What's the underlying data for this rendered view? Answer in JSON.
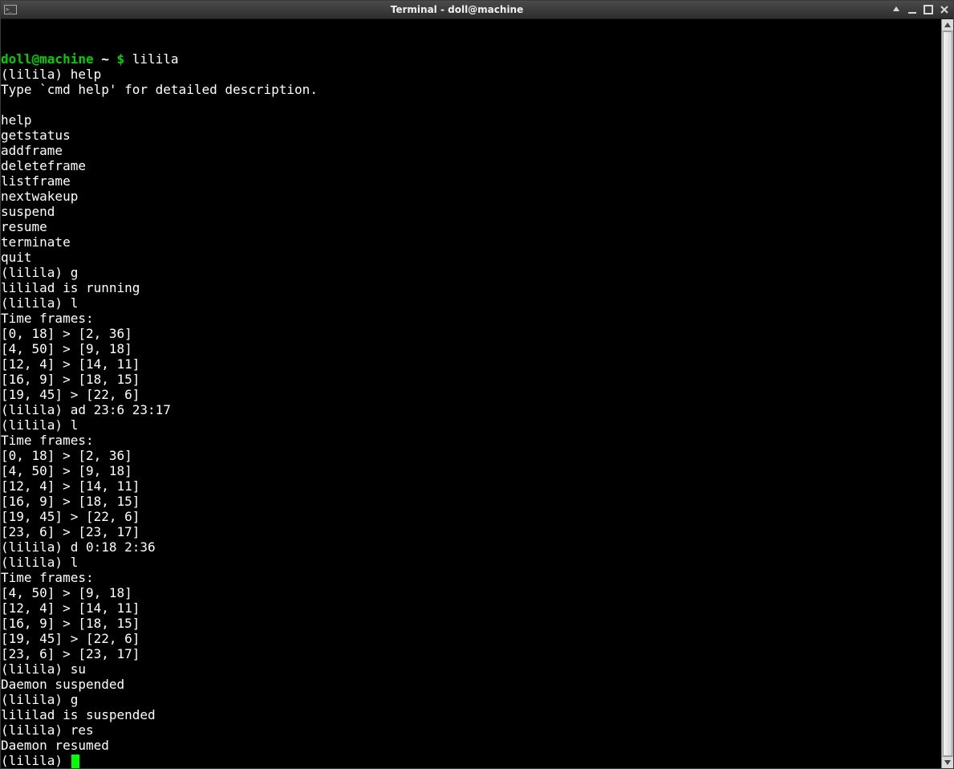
{
  "window": {
    "title": "Terminal - doll@machine"
  },
  "prompt": {
    "user_host": "doll@machine",
    "separator": " ~",
    "sign": " $ ",
    "command": "lilila",
    "sub_prompt": "(lilila) "
  },
  "session": {
    "lines": [
      {
        "t": "shell_prompt"
      },
      {
        "t": "sub",
        "in": "help"
      },
      {
        "t": "out",
        "v": "Type `cmd help' for detailed description."
      },
      {
        "t": "out",
        "v": ""
      },
      {
        "t": "out",
        "v": "help"
      },
      {
        "t": "out",
        "v": "getstatus"
      },
      {
        "t": "out",
        "v": "addframe"
      },
      {
        "t": "out",
        "v": "deleteframe"
      },
      {
        "t": "out",
        "v": "listframe"
      },
      {
        "t": "out",
        "v": "nextwakeup"
      },
      {
        "t": "out",
        "v": "suspend"
      },
      {
        "t": "out",
        "v": "resume"
      },
      {
        "t": "out",
        "v": "terminate"
      },
      {
        "t": "out",
        "v": "quit"
      },
      {
        "t": "sub",
        "in": "g"
      },
      {
        "t": "out",
        "v": "lililad is running"
      },
      {
        "t": "sub",
        "in": "l"
      },
      {
        "t": "out",
        "v": "Time frames:"
      },
      {
        "t": "out",
        "v": "[0, 18] > [2, 36]"
      },
      {
        "t": "out",
        "v": "[4, 50] > [9, 18]"
      },
      {
        "t": "out",
        "v": "[12, 4] > [14, 11]"
      },
      {
        "t": "out",
        "v": "[16, 9] > [18, 15]"
      },
      {
        "t": "out",
        "v": "[19, 45] > [22, 6]"
      },
      {
        "t": "sub",
        "in": "ad 23:6 23:17"
      },
      {
        "t": "sub",
        "in": "l"
      },
      {
        "t": "out",
        "v": "Time frames:"
      },
      {
        "t": "out",
        "v": "[0, 18] > [2, 36]"
      },
      {
        "t": "out",
        "v": "[4, 50] > [9, 18]"
      },
      {
        "t": "out",
        "v": "[12, 4] > [14, 11]"
      },
      {
        "t": "out",
        "v": "[16, 9] > [18, 15]"
      },
      {
        "t": "out",
        "v": "[19, 45] > [22, 6]"
      },
      {
        "t": "out",
        "v": "[23, 6] > [23, 17]"
      },
      {
        "t": "sub",
        "in": "d 0:18 2:36"
      },
      {
        "t": "sub",
        "in": "l"
      },
      {
        "t": "out",
        "v": "Time frames:"
      },
      {
        "t": "out",
        "v": "[4, 50] > [9, 18]"
      },
      {
        "t": "out",
        "v": "[12, 4] > [14, 11]"
      },
      {
        "t": "out",
        "v": "[16, 9] > [18, 15]"
      },
      {
        "t": "out",
        "v": "[19, 45] > [22, 6]"
      },
      {
        "t": "out",
        "v": "[23, 6] > [23, 17]"
      },
      {
        "t": "sub",
        "in": "su"
      },
      {
        "t": "out",
        "v": "Daemon suspended"
      },
      {
        "t": "sub",
        "in": "g"
      },
      {
        "t": "out",
        "v": "lililad is suspended"
      },
      {
        "t": "sub",
        "in": "res"
      },
      {
        "t": "out",
        "v": "Daemon resumed"
      },
      {
        "t": "sub_cursor"
      }
    ]
  }
}
